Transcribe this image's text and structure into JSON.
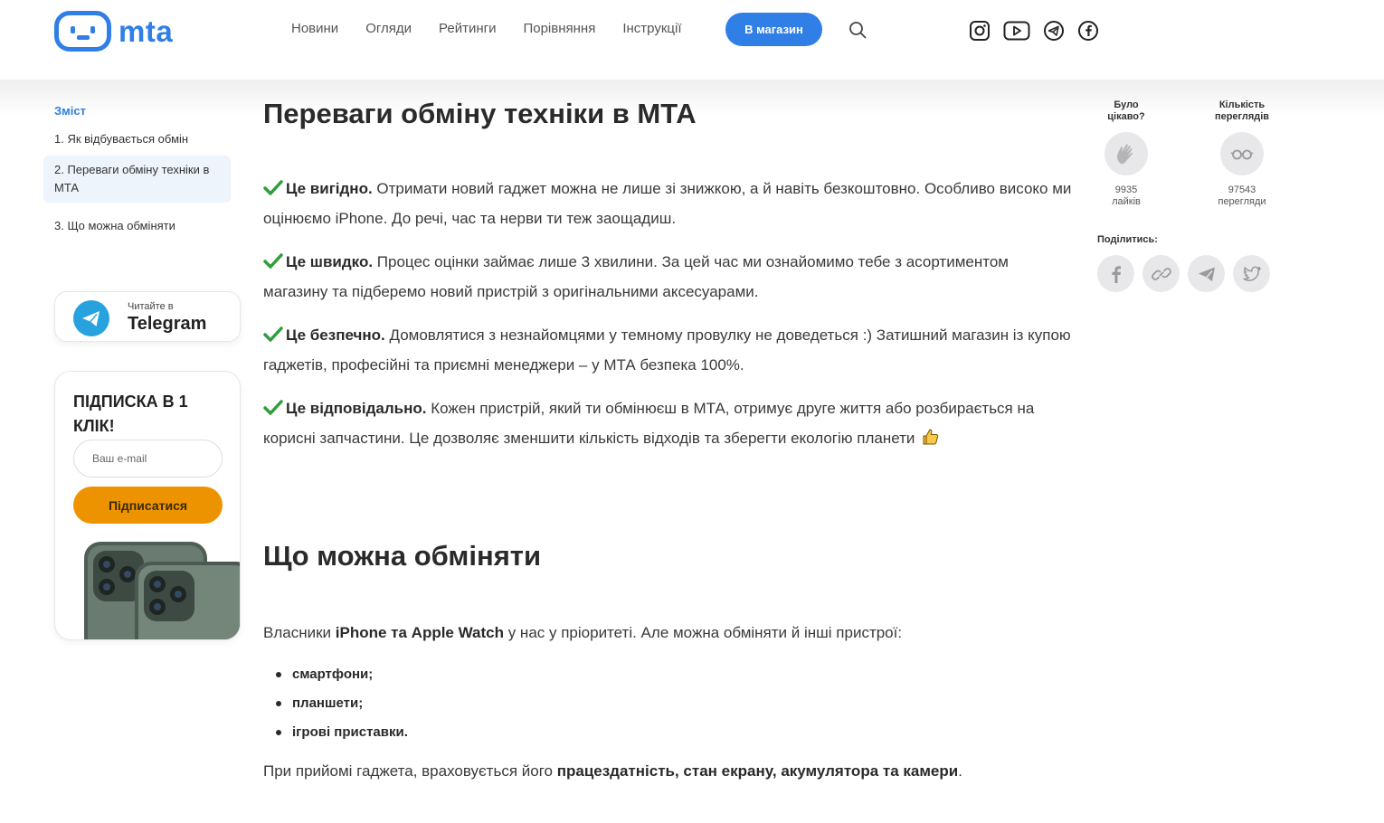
{
  "header": {
    "logo_text": "mta",
    "nav": [
      "Новини",
      "Огляди",
      "Рейтинги",
      "Порівняння",
      "Інструкції"
    ],
    "shop_button": "В магазин"
  },
  "toc": {
    "title": "Зміст",
    "items": [
      "1. Як відбувається обмін",
      "2. Переваги обміну техніки в МТА",
      "3. Що можна обміняти"
    ]
  },
  "telegram": {
    "small": "Читайте в",
    "big": "Telegram"
  },
  "subscribe": {
    "title": "ПІДПИСКА В 1 КЛІК!",
    "placeholder": "Ваш e-mail",
    "button": "Підписатися"
  },
  "article": {
    "h1": "Переваги обміну техніки в МТА",
    "benefits": [
      {
        "bold": "Це вигідно.",
        "text": " Отримати новий гаджет можна не лише зі знижкою, а й навіть безкоштовно. Особливо високо ми оцінюємо iPhone. До речі, час та нерви ти теж заощадиш."
      },
      {
        "bold": "Це швидко.",
        "text": " Процес оцінки займає лише 3 хвилини. За цей час ми ознайомимо тебе з асортиментом магазину та підберемо новий пристрій з оригінальними аксесуарами."
      },
      {
        "bold": "Це безпечно.",
        "text": " Домовлятися з незнайомцями у темному провулку не доведеться :) Затишний магазин із купою гаджетів, професійні та приємні менеджери – у МТА безпека 100%."
      },
      {
        "bold": "Це відповідально.",
        "text": " Кожен пристрій, який ти обмінюєш в МТА, отримує друге життя або розбирається на корисні запчастини. Це дозволяє зменшити кількість відходів та зберегти екологію планети"
      }
    ],
    "h2": "Що можна обміняти",
    "owners_pre": "Власники ",
    "owners_bold": "iPhone та Apple Watch",
    "owners_post": " у нас у пріоритеті. Але можна обміняти й інші пристрої:",
    "list": [
      "смартфони;",
      "планшети;",
      "ігрові приставки."
    ],
    "accept_pre": "При прийомі гаджета, враховується його ",
    "accept_bold": "працездатність, стан екрану, акумулятора та камери",
    "accept_post": "."
  },
  "stats": {
    "liked_label": "Було цікаво?",
    "likes_value": "9935",
    "likes_unit": "лайків",
    "views_label": "Кількість переглядів",
    "views_value": "97543",
    "views_unit": "перегляди",
    "share_label": "Поділитись:"
  },
  "colors": {
    "accent": "#2f7fe6",
    "cta": "#ee9300",
    "check": "#2e9e3a"
  }
}
